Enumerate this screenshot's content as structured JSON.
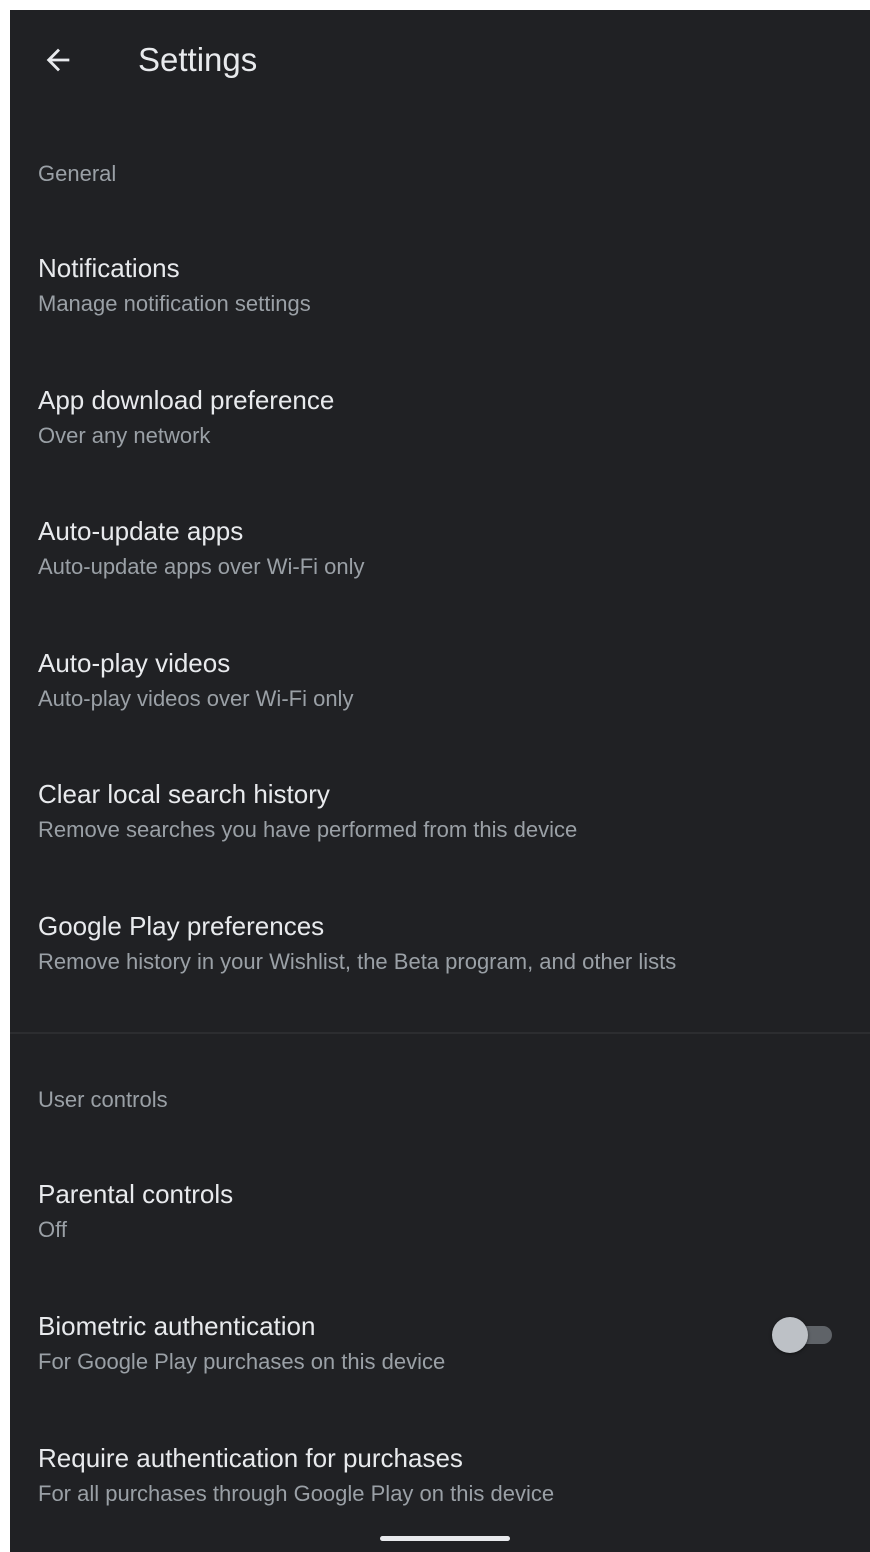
{
  "colors": {
    "background": "#202124",
    "primary_text": "#e8eaed",
    "secondary_text": "#9aa0a6"
  },
  "app_bar": {
    "back_icon": "arrow-back-icon",
    "title": "Settings"
  },
  "sections": [
    {
      "header": "General",
      "items": [
        {
          "title": "Notifications",
          "subtitle": "Manage notification settings"
        },
        {
          "title": "App download preference",
          "subtitle": "Over any network"
        },
        {
          "title": "Auto-update apps",
          "subtitle": "Auto-update apps over Wi-Fi only"
        },
        {
          "title": "Auto-play videos",
          "subtitle": "Auto-play videos over Wi-Fi only"
        },
        {
          "title": "Clear local search history",
          "subtitle": "Remove searches you have performed from this device"
        },
        {
          "title": "Google Play preferences",
          "subtitle": "Remove history in your Wishlist, the Beta program, and other lists"
        }
      ]
    },
    {
      "header": "User controls",
      "items": [
        {
          "title": "Parental controls",
          "subtitle": "Off"
        },
        {
          "title": "Biometric authentication",
          "subtitle": "For Google Play purchases on this device",
          "toggle": false
        },
        {
          "title": "Require authentication for purchases",
          "subtitle": "For all purchases through Google Play on this device"
        }
      ]
    }
  ]
}
